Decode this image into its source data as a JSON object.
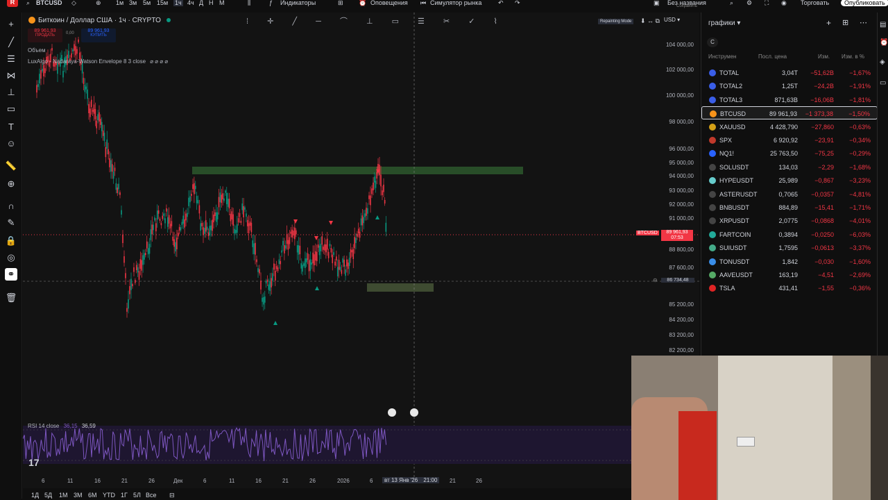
{
  "topbar": {
    "symbol": "BTCUSD",
    "timeframes": [
      "1м",
      "3м",
      "5м",
      "15м",
      "1ч",
      "4ч",
      "Д",
      "Н",
      "М"
    ],
    "indicators_label": "Индикаторы",
    "alerts_label": "Оповещения",
    "replay_label": "Симулятор рынка",
    "layout_name": "Без названия",
    "layout_saved": "Сохранить",
    "trade_label": "Торговать",
    "publish_label": "Опубликовать"
  },
  "chart": {
    "title": "Биткоин / Доллар США · 1ч · CRYPTO",
    "sell_price": "89 961,93",
    "sell_label": "ПРОДАТЬ",
    "spread": "0,00",
    "buy_price": "89 961,93",
    "buy_label": "КУПИТЬ",
    "volume_label": "Объем",
    "indicator_label": "LuxAlgo - Nadaraya-Watson Envelope 8 3 close",
    "repainting_label": "Repainting Mode",
    "currency": "USD",
    "price_ticks": [
      "104 000,00",
      "102 000,00",
      "100 000,00",
      "98 000,00",
      "96 000,00",
      "95 000,00",
      "94 000,00",
      "93 000,00",
      "92 000,00",
      "91 000,00",
      "88 800,00",
      "87 600,00",
      "85 200,00",
      "84 200,00",
      "83 200,00",
      "82 200,00"
    ],
    "current_symbol_tag": "BTCUSD",
    "current_price": "89 961,93",
    "current_countdown": "07:53",
    "crosshair_price": "86 734,48",
    "rsi_label": "RSI 14 close",
    "rsi_value1": "36,15",
    "rsi_value2": "36,59",
    "date_ticks": [
      "6",
      "11",
      "16",
      "21",
      "26",
      "Дек",
      "6",
      "11",
      "16",
      "21",
      "26",
      "2026",
      "6",
      "21",
      "26"
    ],
    "crosshair_date": "вт 13 Янв '26",
    "crosshair_time": "21:00"
  },
  "bottombar": {
    "ranges": [
      "1Д",
      "5Д",
      "1М",
      "3М",
      "6М",
      "YTD",
      "1Г",
      "5Л",
      "Все"
    ]
  },
  "watchlist": {
    "title": "графики",
    "section": "C",
    "col_symbol": "Инструмен",
    "col_last": "Посл. цена",
    "col_chg": "Изм.",
    "col_chgp": "Изм. в %",
    "rows": [
      {
        "sym": "TOTAL",
        "last": "3,04T",
        "chg": "−51,62B",
        "chgp": "−1,67%",
        "color": "#3a5ee8"
      },
      {
        "sym": "TOTAL2",
        "last": "1,25T",
        "chg": "−24,2B",
        "chgp": "−1,91%",
        "color": "#3a5ee8"
      },
      {
        "sym": "TOTAL3",
        "last": "871,63B",
        "chg": "−16,06B",
        "chgp": "−1,81%",
        "color": "#3a5ee8"
      },
      {
        "sym": "BTCUSD",
        "last": "89 961,93",
        "chg": "−1 373,38",
        "chgp": "−1,50%",
        "color": "#f7931a"
      },
      {
        "sym": "XAUUSD",
        "last": "4 428,790",
        "chg": "−27,860",
        "chgp": "−0,63%",
        "color": "#d4a017"
      },
      {
        "sym": "SPX",
        "last": "6 920,92",
        "chg": "−23,91",
        "chgp": "−0,34%",
        "color": "#c0392b"
      },
      {
        "sym": "NQ1!",
        "last": "25 763,50",
        "chg": "−75,25",
        "chgp": "−0,29%",
        "color": "#2962ff"
      },
      {
        "sym": "SOLUSDT",
        "last": "134,03",
        "chg": "−2,29",
        "chgp": "−1,68%",
        "color": "#444"
      },
      {
        "sym": "HYPEUSDT",
        "last": "25,989",
        "chg": "−0,867",
        "chgp": "−3,23%",
        "color": "#6cc"
      },
      {
        "sym": "ASTERUSDT",
        "last": "0,7065",
        "chg": "−0,0357",
        "chgp": "−4,81%",
        "color": "#444"
      },
      {
        "sym": "BNBUSDT",
        "last": "884,89",
        "chg": "−15,41",
        "chgp": "−1,71%",
        "color": "#444"
      },
      {
        "sym": "XRPUSDT",
        "last": "2,0775",
        "chg": "−0,0868",
        "chgp": "−4,01%",
        "color": "#444"
      },
      {
        "sym": "FARTCOIN",
        "last": "0,3894",
        "chg": "−0,0250",
        "chgp": "−6,03%",
        "color": "#2a9"
      },
      {
        "sym": "SUIUSDT",
        "last": "1,7595",
        "chg": "−0,0613",
        "chgp": "−3,37%",
        "color": "#4a8"
      },
      {
        "sym": "TONUSDT",
        "last": "1,842",
        "chg": "−0,030",
        "chgp": "−1,60%",
        "color": "#3a8ee8"
      },
      {
        "sym": "AAVEUSDT",
        "last": "163,19",
        "chg": "−4,51",
        "chgp": "−2,69%",
        "color": "#5a6"
      },
      {
        "sym": "TSLA",
        "last": "431,41",
        "chg": "−1,55",
        "chgp": "−0,36%",
        "color": "#e02424"
      }
    ]
  },
  "colors": {
    "down": "#f23645",
    "up": "#089981",
    "accent": "#2962ff",
    "rsi": "#7e57c2"
  }
}
